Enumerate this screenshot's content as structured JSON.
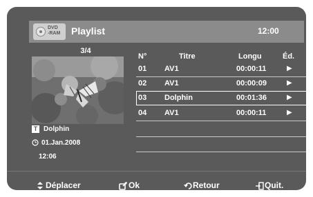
{
  "header": {
    "disc_label_line1": "DVD",
    "disc_label_line2": "-RAM",
    "title": "Playlist",
    "clock": "12:00"
  },
  "preview": {
    "counter": "3/4",
    "title": "Dolphin",
    "date": "01.Jan.2008",
    "time": "12:06"
  },
  "table": {
    "headers": [
      "N°",
      "Titre",
      "Longu",
      "Éd."
    ],
    "rows": [
      {
        "no": "01",
        "title": "AV1",
        "length": "00:00:11",
        "action": "▶"
      },
      {
        "no": "02",
        "title": "AV1",
        "length": "00:00:09",
        "action": "▶"
      },
      {
        "no": "03",
        "title": "Dolphin",
        "length": "00:01:36",
        "action": "▶"
      },
      {
        "no": "04",
        "title": "AV1",
        "length": "00:00:11",
        "action": "▶"
      }
    ],
    "selected_index": 2
  },
  "footer": {
    "move": "Déplacer",
    "ok": "Ok",
    "back": "Retour",
    "quit": "Quit."
  }
}
